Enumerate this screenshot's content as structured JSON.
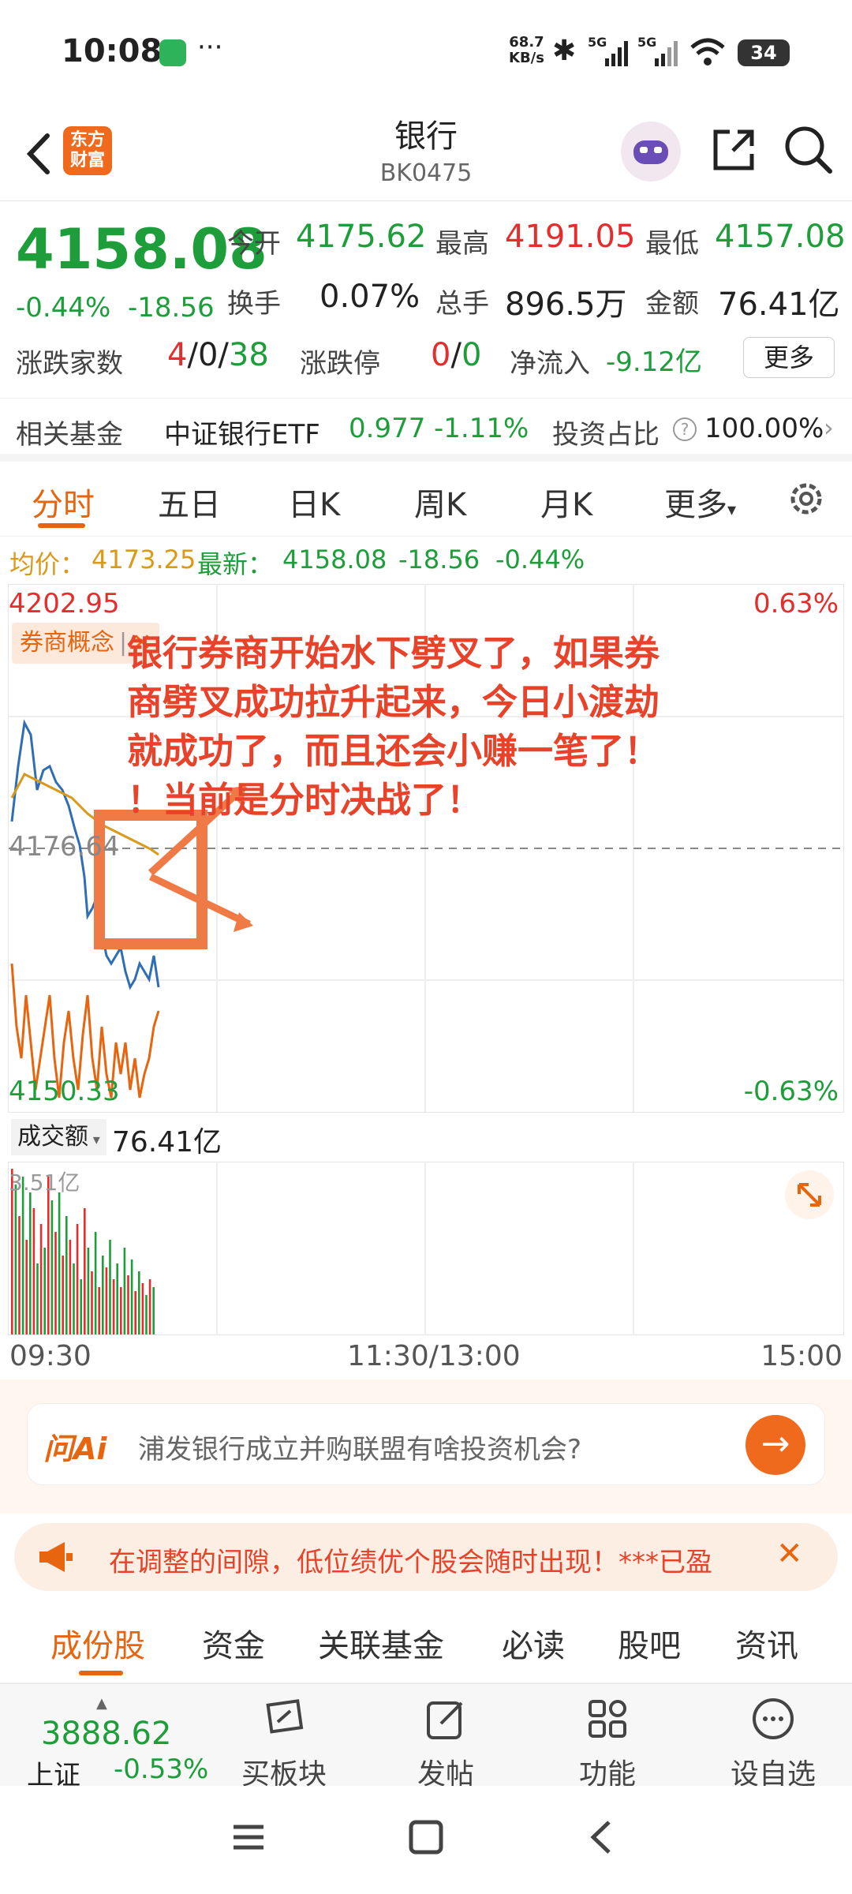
{
  "status_bar": {
    "time": "10:08",
    "speed_top": "68.7",
    "speed_bottom": "KB/s",
    "net1": "5G",
    "net2": "5G",
    "battery": "34",
    "more": "···"
  },
  "header": {
    "title": "银行",
    "code": "BK0475",
    "logo_line1": "东方",
    "logo_line2": "财富"
  },
  "quote": {
    "price": "4158.08",
    "change_pct": "-0.44%",
    "change": "-18.56",
    "open_label": "今开",
    "open": "4175.62",
    "high_label": "最高",
    "high": "4191.05",
    "low_label": "最低",
    "low": "4157.08",
    "turnover_label": "换手",
    "turnover": "0.07%",
    "volume_label": "总手",
    "volume": "896.5万",
    "amount_label": "金额",
    "amount": "76.41亿",
    "breadth_label": "涨跌家数",
    "up": "4",
    "sep1": "/",
    "flat": "0",
    "sep2": "/",
    "down": "38",
    "limit_label": "涨跌停",
    "limit_up": "0",
    "sep3": "/",
    "limit_down": "0",
    "inflow_label": "净流入",
    "inflow": "-9.12亿",
    "more_button": "更多"
  },
  "fund": {
    "label": "相关基金",
    "name": "中证银行ETF",
    "price": "0.977",
    "pct": "-1.11%",
    "ratio_label": "投资占比",
    "ratio": "100.00%"
  },
  "tabs": [
    "分时",
    "五日",
    "日K",
    "周K",
    "月K",
    "更多"
  ],
  "avg_line": {
    "avg_label": "均价：",
    "avg_value": "4173.25",
    "latest_label": "最新：",
    "latest_value": "4158.08",
    "change": "-18.56",
    "pct": "-0.44%"
  },
  "chart": {
    "top_price": "4202.95",
    "top_pct": "0.63%",
    "mid_price": "4176.64",
    "bottom_price": "4150.33",
    "bottom_pct": "-0.63%",
    "tag": "券商概念",
    "annotation_lines": [
      "银行券商开始水下劈叉了，如果券",
      "商劈叉成功拉升起来，今日小渡劫",
      "就成功了，而且还会小赚一笔了！",
      "！当前是分时决战了！"
    ]
  },
  "volume": {
    "selector": "成交额",
    "value": "76.41亿",
    "max_label": "3.51亿"
  },
  "times": {
    "start": "09:30",
    "mid": "11:30/13:00",
    "end": "15:00"
  },
  "ai": {
    "logo": "问Ai",
    "prompt": "浦发银行成立并购联盟有啥投资机会?"
  },
  "notice": {
    "text": "在调整的间隙，低位绩优个股会随时出现！***已盈"
  },
  "subtabs": [
    "成份股",
    "资金",
    "关联基金",
    "必读",
    "股吧",
    "资讯"
  ],
  "bottom": {
    "index_value": "3888.62",
    "index_name": "上证",
    "index_pct": "-0.53%",
    "buy": "买板块",
    "post": "发帖",
    "func": "功能",
    "watch": "设自选"
  },
  "colors": {
    "accent": "#e8650f",
    "up": "#e52d2d",
    "down": "#1e9e3a",
    "annotation": "#e8432a"
  }
}
